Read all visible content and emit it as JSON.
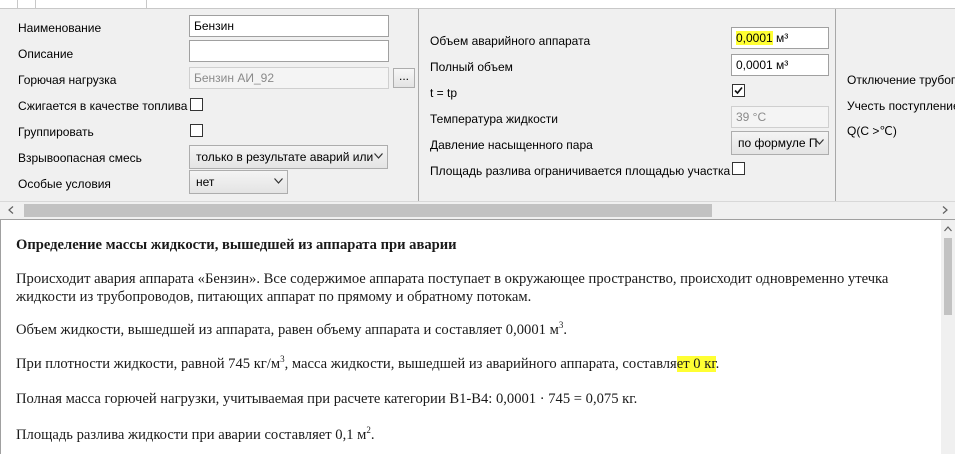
{
  "props": {
    "col1": {
      "name_label": "Наименование",
      "name_value": "Бензин",
      "description_label": "Описание",
      "description_value": "",
      "fuel_load_label": "Горючая нагрузка",
      "fuel_load_value": "Бензин АИ_92",
      "ellipsis_label": "...",
      "burned_as_fuel_label": "Сжигается в качестве топлива",
      "burned_as_fuel_checked": false,
      "group_label": "Группировать",
      "group_checked": false,
      "explosive_mix_label": "Взрывоопасная смесь",
      "explosive_mix_value": "только в результате аварий или",
      "special_conditions_label": "Особые условия",
      "special_conditions_value": "нет"
    },
    "col2": {
      "emergency_volume_label": "Объем аварийного аппарата",
      "emergency_volume_number": "0,0001",
      "emergency_volume_unit": "м³",
      "full_volume_label": "Полный объем",
      "full_volume_value": "0,0001 м³",
      "t_eq_tp_label": "t = tp",
      "t_eq_tp_checked": true,
      "liquid_temp_label": "Температура жидкости",
      "liquid_temp_value": "39 °C",
      "vapor_pressure_label": "Давление насыщенного пара",
      "vapor_pressure_value": "по формуле П",
      "spill_limited_label": "Площадь разлива ограничивается площадью участка",
      "spill_limited_checked": false
    },
    "col3": {
      "pipe_shutoff_label": "Отключение трубопр",
      "account_inflow_label": "Учесть поступление",
      "q_label": "Q(C >℃)"
    }
  },
  "report": {
    "heading": "Определение массы жидкости, вышедшей из аппарата при аварии",
    "p1": "Происходит авария аппарата «Бензин». Все содержимое аппарата поступает в окружающее пространство, происходит одновременно утечка жидкости из трубопроводов, питающих аппарат по прямому и обратному потокам.",
    "p2_text": "Объем жидкости, вышедшей из аппарата, равен объему аппарата и составляет 0,0001 м",
    "p2_sup": "3",
    "p2_end": ".",
    "p3_a": "При плотности жидкости, равной 745 кг/м",
    "p3_sup": "3",
    "p3_b": ", масса жидкости, вышедшей из аварийного аппарата, составля",
    "p3_hl": "ет 0 кг",
    "p3_end": ".",
    "p4": "Полная масса горючей нагрузки, учитываемая при расчете категории В1-В4: 0,0001 · 745 = 0,075 кг.",
    "p5_text": "Площадь разлива жидкости при аварии составляет 0,1 м",
    "p5_sup": "2",
    "p5_end": "."
  },
  "colors": {
    "highlight": "#ffff33",
    "panel_bg": "#f0f0f0"
  }
}
